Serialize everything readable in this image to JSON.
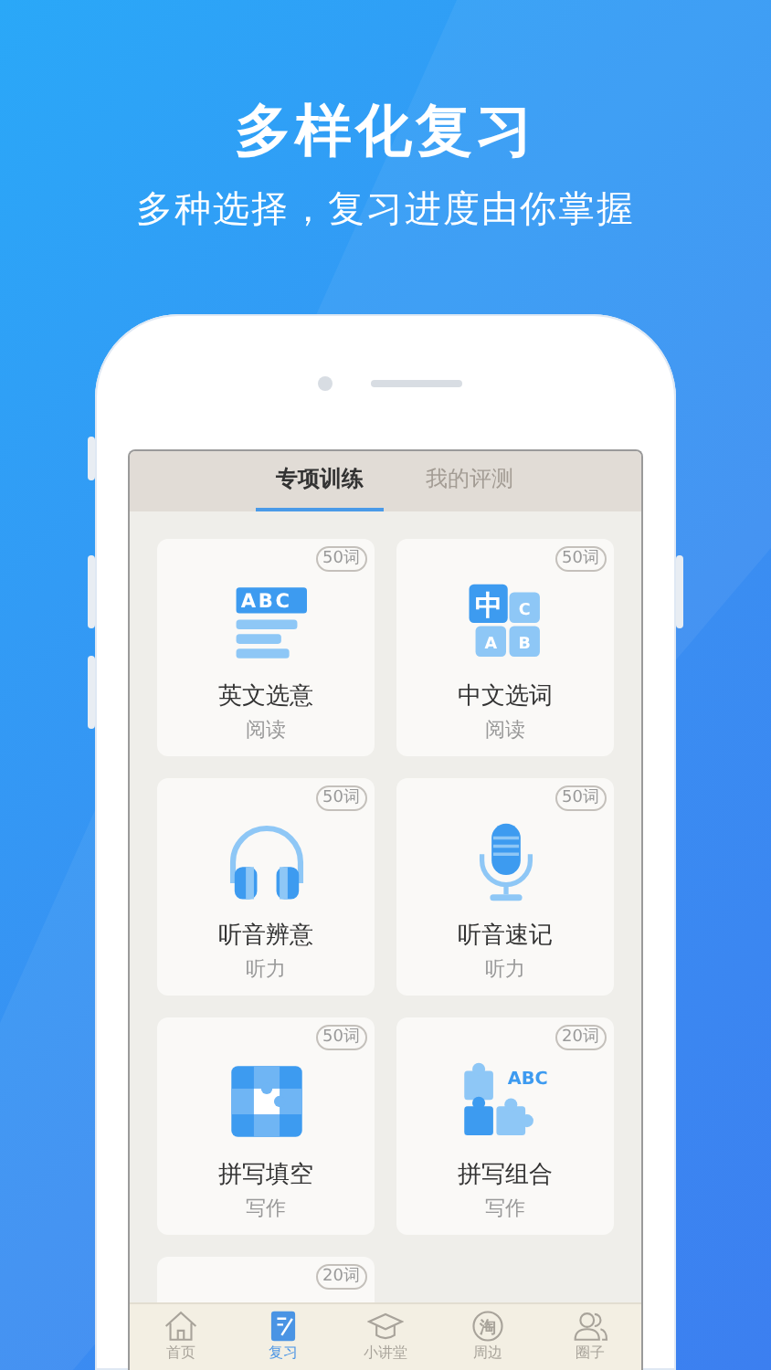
{
  "headline": "多样化复习",
  "subtitle": "多种选择，复习进度由你掌握",
  "tabs": [
    {
      "label": "专项训练",
      "selected": true
    },
    {
      "label": "我的评测",
      "selected": false
    }
  ],
  "cards": [
    {
      "title": "英文选意",
      "category": "阅读",
      "badge": "50词",
      "icon_letters": [
        "ABC"
      ]
    },
    {
      "title": "中文选词",
      "category": "阅读",
      "badge": "50词",
      "icon_letters": [
        "中",
        "C",
        "A",
        "B"
      ]
    },
    {
      "title": "听音辨意",
      "category": "听力",
      "badge": "50词"
    },
    {
      "title": "听音速记",
      "category": "听力",
      "badge": "50词"
    },
    {
      "title": "拼写填空",
      "category": "写作",
      "badge": "50词"
    },
    {
      "title": "拼写组合",
      "category": "写作",
      "badge": "20词",
      "icon_letters": [
        "ABC"
      ]
    }
  ],
  "partial_card": {
    "badge": "20词"
  },
  "bottom_nav": [
    {
      "label": "首页",
      "selected": false
    },
    {
      "label": "复习",
      "selected": true
    },
    {
      "label": "小讲堂",
      "selected": false
    },
    {
      "label": "周边",
      "selected": false,
      "icon_letter": "淘"
    },
    {
      "label": "圈子",
      "selected": false
    }
  ]
}
